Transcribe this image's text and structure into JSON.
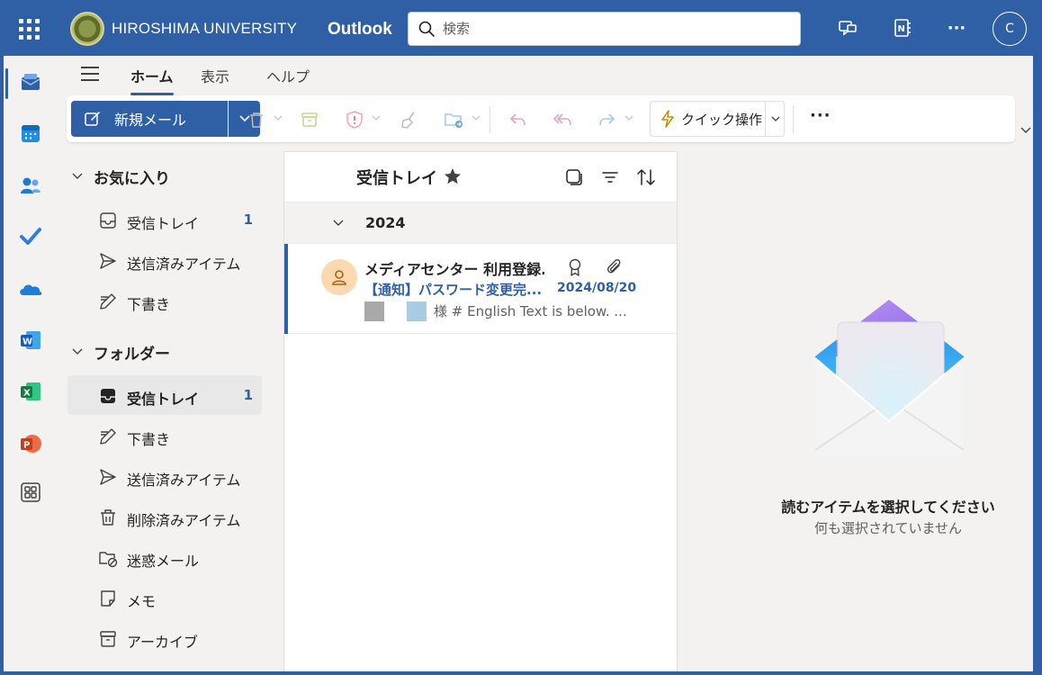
{
  "header": {
    "logo_text": "HIROSHIMA UNIVERSITY",
    "app_name": "Outlook",
    "search_placeholder": "検索",
    "more_label": "···",
    "avatar_initial": "C"
  },
  "ribbon": {
    "tabs": [
      {
        "label": "ホーム",
        "active": true
      },
      {
        "label": "表示",
        "active": false
      },
      {
        "label": "ヘルプ",
        "active": false
      }
    ],
    "new_mail_label": "新規メール",
    "quick_steps_label": "クイック操作",
    "more_label": "···"
  },
  "folders": {
    "favorites_title": "お気に入り",
    "favorites": [
      {
        "label": "受信トレイ",
        "count": "1",
        "icon": "inbox-icon"
      },
      {
        "label": "送信済みアイテム",
        "count": "",
        "icon": "send-icon"
      },
      {
        "label": "下書き",
        "count": "",
        "icon": "draft-icon"
      }
    ],
    "folders_title": "フォルダー",
    "items": [
      {
        "label": "受信トレイ",
        "count": "1",
        "icon": "inbox-icon",
        "selected": true
      },
      {
        "label": "下書き",
        "count": "",
        "icon": "draft-icon"
      },
      {
        "label": "送信済みアイテム",
        "count": "",
        "icon": "send-icon"
      },
      {
        "label": "削除済みアイテム",
        "count": "",
        "icon": "trash-icon"
      },
      {
        "label": "迷惑メール",
        "count": "",
        "icon": "junk-icon"
      },
      {
        "label": "メモ",
        "count": "",
        "icon": "note-icon"
      },
      {
        "label": "アーカイブ",
        "count": "",
        "icon": "archive-icon"
      }
    ]
  },
  "message_list": {
    "title": "受信トレイ",
    "group_label": "2024",
    "messages": [
      {
        "sender": "メディアセンター 利用登録...",
        "subject": "【通知】パスワード変更完...",
        "date": "2024/08/20",
        "preview": "様 # English Text is below. ...",
        "unread": true
      }
    ]
  },
  "reading_pane": {
    "title": "読むアイテムを選択してください",
    "subtitle": "何も選択されていません"
  },
  "colors": {
    "brand": "#2f5fa5",
    "surface": "#f3f2f1",
    "unread_accent": "#2f5fa5"
  }
}
